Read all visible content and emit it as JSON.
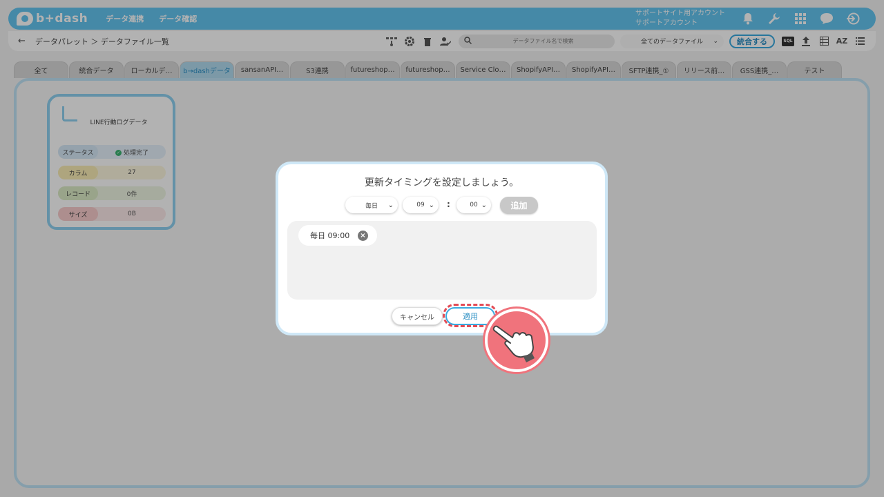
{
  "header": {
    "logo_text": "b+dash",
    "nav": [
      "データ連携",
      "データ確認"
    ],
    "account_line1": "サポートサイト用アカウント",
    "account_line2": "サポートアカウント",
    "icons": [
      "bell-icon",
      "wrench-icon",
      "grid-icon",
      "chat-icon",
      "logout-icon"
    ]
  },
  "subbar": {
    "breadcrumb": "データパレット ＞ データファイル一覧",
    "search_placeholder": "データファイル名で検索",
    "file_filter": "全てのデータファイル",
    "merge_label": "統合する",
    "sql_label": "SQL"
  },
  "tabs": [
    "全て",
    "統合データ",
    "ローカルデ…",
    "b→dashデータ",
    "sansanAPI…",
    "S3連携",
    "futureshop…",
    "futureshop…",
    "Service Clo…",
    "ShopifyAPI…",
    "ShopifyAPI…",
    "SFTP連携_①",
    "リリース前…",
    "GSS連携_…",
    "テスト"
  ],
  "active_tab_index": 3,
  "card": {
    "title": "LINE行動ログデータ",
    "rows": [
      {
        "label": "ステータス",
        "value": "処理完了"
      },
      {
        "label": "カラム",
        "value": "27"
      },
      {
        "label": "レコード",
        "value": "0件"
      },
      {
        "label": "サイズ",
        "value": "0B"
      }
    ]
  },
  "dialog": {
    "title": "更新タイミングを設定しましょう。",
    "frequency": "毎日",
    "hour": "09",
    "colon": ":",
    "minute": "00",
    "add_label": "追加",
    "timings": [
      "毎日 09:00"
    ],
    "cancel_label": "キャンセル",
    "apply_label": "適用"
  },
  "colors": {
    "brand": "#64c4ef",
    "highlight": "#e34b55"
  }
}
